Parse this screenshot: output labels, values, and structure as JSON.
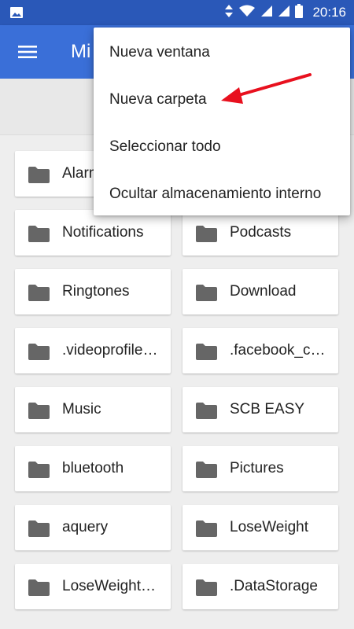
{
  "status_bar": {
    "time": "20:16",
    "icons": [
      "gallery-icon",
      "data-arrows-icon",
      "wifi-icon",
      "signal-icon",
      "signal-icon",
      "battery-icon"
    ]
  },
  "app_bar": {
    "title_partial": "Mi",
    "menu_icon": "menu-icon"
  },
  "overflow_menu": {
    "items": [
      {
        "label": "Nueva ventana"
      },
      {
        "label": "Nueva carpeta"
      },
      {
        "label": "Seleccionar todo"
      },
      {
        "label": "Ocultar almacenamiento interno"
      }
    ]
  },
  "annotation": {
    "arrow_color": "#e8101e",
    "points_to": "Nueva carpeta"
  },
  "folders": [
    {
      "name": "Alarms"
    },
    {
      "name": ""
    },
    {
      "name": "Notifications"
    },
    {
      "name": "Podcasts"
    },
    {
      "name": "Ringtones"
    },
    {
      "name": "Download"
    },
    {
      "name": ".videoprofile…"
    },
    {
      "name": ".facebook_c…"
    },
    {
      "name": "Music"
    },
    {
      "name": "SCB EASY"
    },
    {
      "name": "bluetooth"
    },
    {
      "name": "Pictures"
    },
    {
      "name": "aquery"
    },
    {
      "name": "LoseWeight"
    },
    {
      "name": "LoseWeight…"
    },
    {
      "name": ".DataStorage"
    }
  ],
  "colors": {
    "status_bar": "#2a58b8",
    "app_bar": "#3a6fd8",
    "folder_icon": "#666666"
  }
}
